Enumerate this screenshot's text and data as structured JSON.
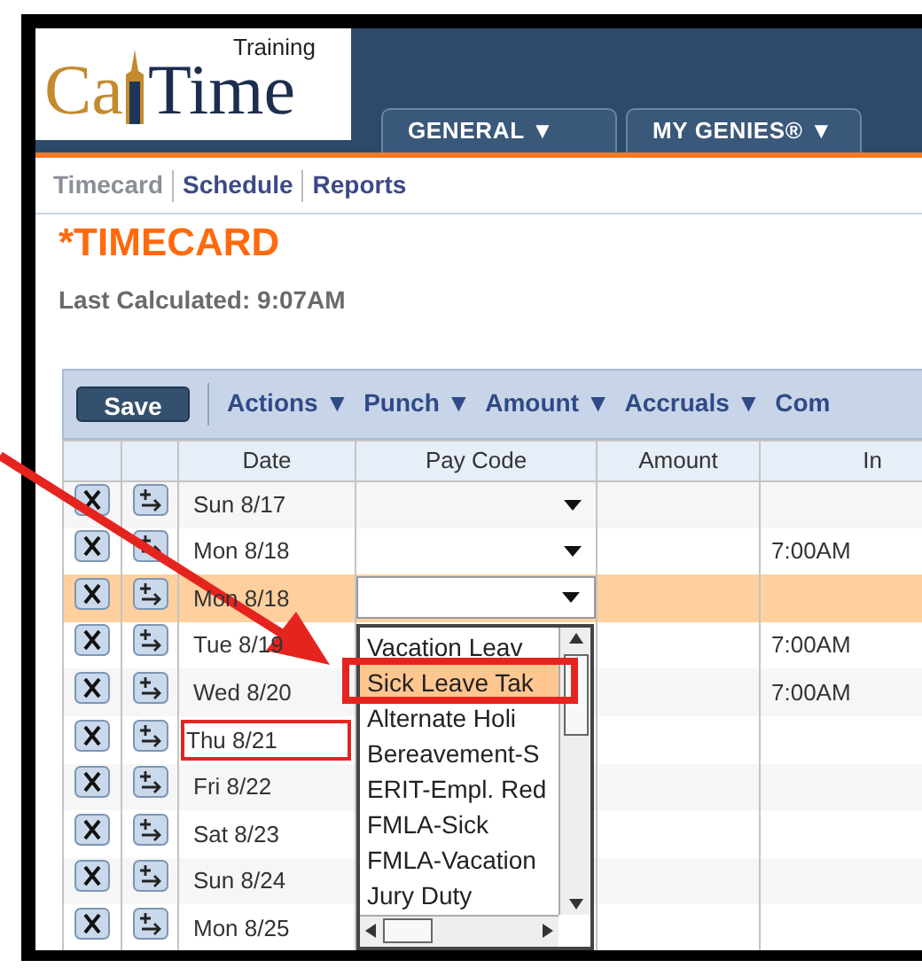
{
  "logo": {
    "left": "Ca",
    "right": "Time",
    "tag": "Training"
  },
  "nav_tabs": [
    {
      "label": "GENERAL ▼"
    },
    {
      "label": "MY GENIES® ▼"
    }
  ],
  "subnav": [
    {
      "label": "Timecard",
      "selected": true
    },
    {
      "label": "Schedule",
      "selected": false
    },
    {
      "label": "Reports",
      "selected": false
    }
  ],
  "page_title": "*TIMECARD",
  "last_calculated": "Last Calculated: 9:07AM",
  "toolbar": {
    "save": "Save",
    "menus": [
      "Actions ▼",
      "Punch ▼",
      "Amount ▼",
      "Accruals ▼",
      "Com"
    ]
  },
  "table": {
    "columns": [
      "Date",
      "Pay Code",
      "Amount",
      "In"
    ],
    "rows": [
      {
        "date": "Sun 8/17",
        "pay_code_arrow": true,
        "in": "",
        "selected": false,
        "outlined": false
      },
      {
        "date": "Mon 8/18",
        "pay_code_arrow": true,
        "in": "7:00AM",
        "selected": false,
        "outlined": false
      },
      {
        "date": "Mon 8/18",
        "pay_code_arrow": true,
        "in": "",
        "selected": true,
        "outlined": false
      },
      {
        "date": "Tue 8/19",
        "in": "7:00AM",
        "selected": false,
        "outlined": false
      },
      {
        "date": "Wed 8/20",
        "in": "7:00AM",
        "selected": false,
        "outlined": false
      },
      {
        "date": "Thu 8/21",
        "in": "",
        "selected": false,
        "outlined": true
      },
      {
        "date": "Fri 8/22",
        "in": "",
        "selected": false,
        "outlined": false
      },
      {
        "date": "Sat 8/23",
        "in": "",
        "selected": false,
        "outlined": false
      },
      {
        "date": "Sun 8/24",
        "in": "",
        "selected": false,
        "outlined": false
      },
      {
        "date": "Mon 8/25",
        "in": "",
        "selected": false,
        "outlined": false
      }
    ]
  },
  "pay_code_list": [
    {
      "label": "Vacation Leav",
      "selected": false,
      "outlined": false
    },
    {
      "label": "Sick Leave Tak",
      "selected": true,
      "outlined": true
    },
    {
      "label": "Alternate Holi",
      "selected": false,
      "outlined": false
    },
    {
      "label": "Bereavement-S",
      "selected": false,
      "outlined": false
    },
    {
      "label": "ERIT-Empl. Red",
      "selected": false,
      "outlined": false
    },
    {
      "label": "FMLA-Sick",
      "selected": false,
      "outlined": false
    },
    {
      "label": "FMLA-Vacation",
      "selected": false,
      "outlined": false
    },
    {
      "label": "Jury Duty",
      "selected": false,
      "outlined": false
    }
  ]
}
